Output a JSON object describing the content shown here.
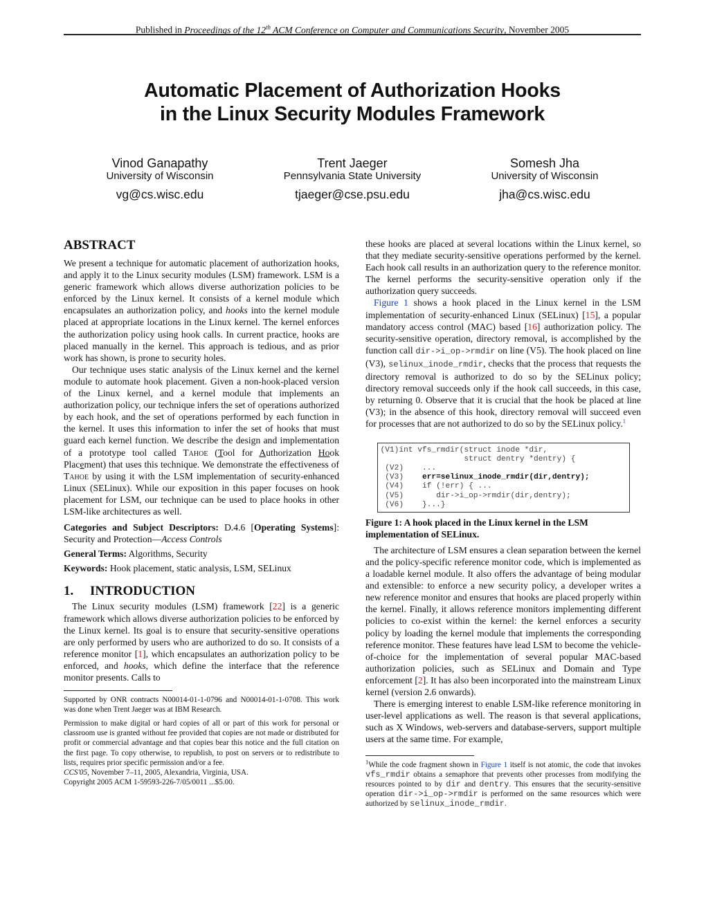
{
  "header": {
    "prefix": "Published in ",
    "venue_pre": "Proceedings of the 12",
    "venue_sup": "th",
    "venue_post": " ACM Conference on Computer and Communications Security",
    "suffix": ", November 2005"
  },
  "title": {
    "line1": "Automatic Placement of Authorization Hooks",
    "line2": "in the Linux Security Modules Framework"
  },
  "authors": [
    {
      "name": "Vinod Ganapathy",
      "affiliation": "University of Wisconsin",
      "email": "vg@cs.wisc.edu"
    },
    {
      "name": "Trent Jaeger",
      "affiliation": "Pennsylvania State University",
      "email": "tjaeger@cse.psu.edu"
    },
    {
      "name": "Somesh Jha",
      "affiliation": "University of Wisconsin",
      "email": "jha@cs.wisc.edu"
    }
  ],
  "abstract": {
    "heading": "ABSTRACT",
    "p1_a": "We present a technique for automatic placement of authorization hooks, and apply it to the Linux security modules (LSM) framework. LSM is a generic framework which allows diverse authorization policies to be enforced by the Linux kernel. It consists of a kernel module which encapsulates an authorization policy, and ",
    "p1_em": "hooks",
    "p1_b": " into the kernel module placed at appropriate locations in the Linux kernel. The kernel enforces the authorization policy using hook calls. In current practice, hooks are placed manually in the kernel. This approach is tedious, and as prior work has shown, is prone to security holes.",
    "p2_a": "Our technique uses static analysis of the Linux kernel and the kernel module to automate hook placement. Given a non-hook-placed version of the Linux kernel, and a kernel module that implements an authorization policy, our technique infers the set of operations authorized by each hook, and the set of operations performed by each function in the kernel. It uses this information to infer the set of hooks that must guard each kernel function. We describe the design and implementation of a prototype tool called ",
    "tool_name": "Tahoe",
    "p2_b": " (",
    "acr_T": "T",
    "acr_1": "ool for ",
    "acr_A": "A",
    "acr_2": "uthorization ",
    "acr_Ho": "Ho",
    "acr_3": "ok Plac",
    "acr_e": "e",
    "acr_4": "ment) that uses this technique. We demonstrate the effectiveness of ",
    "p2_c": " by using it with the LSM implementation of security-enhanced Linux (SELinux). While our exposition in this paper focuses on hook placement for LSM, our technique can be used to place hooks in other LSM-like architectures as well."
  },
  "categories": {
    "label": "Categories and Subject Descriptors:",
    "code": " D.4.6 [",
    "bold_term": "Operating Systems",
    "rest": "]: Security and Protection—",
    "italic": "Access Controls"
  },
  "general_terms": {
    "label": "General Terms:",
    "value": " Algorithms, Security"
  },
  "keywords": {
    "label": "Keywords:",
    "value": " Hook placement, static analysis, LSM, SELinux"
  },
  "introduction": {
    "number": "1.",
    "heading": "INTRODUCTION",
    "p1_a": "The Linux security modules (LSM) framework [",
    "ref22": "22",
    "p1_b": "] is a generic framework which allows diverse authorization policies to be enforced by the Linux kernel. Its goal is to ensure that security-sensitive operations are only performed by users who are authorized to do so. It consists of a reference monitor [",
    "ref1": "1",
    "p1_c": "], which encapsulates an authorization policy to be enforced, and ",
    "p1_em": "hooks",
    "p1_d": ", which define the interface that the reference monitor presents. Calls to"
  },
  "left_footnotes": {
    "support": "Supported by ONR contracts N00014-01-1-0796 and N00014-01-1-0708. This work was done when Trent Jaeger was at IBM Research.",
    "permission": "Permission to make digital or hard copies of all or part of this work for personal or classroom use is granted without fee provided that copies are not made or distributed for profit or commercial advantage and that copies bear this notice and the full citation on the first page. To copy otherwise, to republish, to post on servers or to redistribute to lists, requires prior specific permission and/or a fee.",
    "conf_italic": "CCS'05,",
    "conf_rest": " November 7–11, 2005, Alexandria, Virginia, USA.",
    "copyright": "Copyright 2005 ACM 1-59593-226-7/05/0011 ...$5.00."
  },
  "right": {
    "p_cont": "these hooks are placed at several locations within the Linux kernel, so that they mediate security-sensitive operations performed by the kernel. Each hook call results in an authorization query to the reference monitor. The kernel performs the security-sensitive operation only if the authorization query succeeds.",
    "p2_figref": "Figure 1",
    "p2_a": " shows a hook placed in the Linux kernel in the LSM implementation of security-enhanced Linux (SELinux) [",
    "ref15": "15",
    "p2_b": "], a popular mandatory access control (MAC) based [",
    "ref16": "16",
    "p2_c": "] authorization policy. The security-sensitive operation, directory removal, is accomplished by the function call ",
    "code1": "dir->i_op->rmdir",
    "p2_d": " on line (V5). The hook placed on line (V3), ",
    "code2": "selinux_inode_rmdir",
    "p2_e": ", checks that the process that requests the directory removal is authorized to do so by the SELinux policy; directory removal succeeds only if the hook call succeeds, in this case, by returning 0. Observe that it is crucial that the hook be placed at line (V3); in the absence of this hook, directory removal will succeed even for processes that are not authorized to do so by the SELinux policy.",
    "fn_mark": "1",
    "figure": {
      "lines": [
        {
          "label": "(V1)",
          "code": "int vfs_rmdir(struct inode *dir,",
          "bold": false
        },
        {
          "label": "",
          "code": "              struct dentry *dentry) {",
          "bold": false
        },
        {
          "label": "(V2)",
          "code": "   ...",
          "bold": false
        },
        {
          "label": "(V3)",
          "code": "   err=selinux_inode_rmdir(dir,dentry);",
          "bold": true
        },
        {
          "label": "(V4)",
          "code": "   if (!err) { ...",
          "bold": false
        },
        {
          "label": "(V5)",
          "code": "      dir->i_op->rmdir(dir,dentry);",
          "bold": false
        },
        {
          "label": "(V6)",
          "code": "   }...}",
          "bold": false
        }
      ],
      "caption": "Figure 1: A hook placed in the Linux kernel in the LSM implementation of SELinux."
    },
    "p3_a": "The architecture of LSM ensures a clean separation between the kernel and the policy-specific reference monitor code, which is implemented as a loadable kernel module. It also offers the advantage of being modular and extensible: to enforce a new security policy, a developer writes a new reference monitor and ensures that hooks are placed properly within the kernel. Finally, it allows reference monitors implementing different policies to co-exist within the kernel: the kernel enforces a security policy by loading the kernel module that implements the corresponding reference monitor. These features have lead LSM to become the vehicle-of-choice for the implementation of several popular MAC-based authorization policies, such as SELinux and Domain and Type enforcement [",
    "ref2": "2",
    "p3_b": "]. It has also been incorporated into the mainstream Linux kernel (version 2.6 onwards).",
    "p4": "There is emerging interest to enable LSM-like reference monitoring in user-level applications as well. The reason is that several applications, such as X Windows, web-servers and database-servers, support multiple users at the same time. For example,",
    "footnote": {
      "mark": "1",
      "a": "While the code fragment shown in ",
      "figref": "Figure 1",
      "b": " itself is not atomic, the code that invokes ",
      "c1": "vfs_rmdir",
      "c": " obtains a semaphore that prevents other processes from modifying the resources pointed to by ",
      "c2": "dir",
      "d": " and ",
      "c3": "dentry",
      "e": ". This ensures that the security-sensitive operation ",
      "c4": "dir->i_op->rmdir",
      "f": " is performed on the same resources which were authorized by ",
      "c5": "selinux_inode_rmdir",
      "g": "."
    }
  },
  "colors": {
    "citation": "#d42020",
    "figure_link": "#1a3ccc"
  }
}
